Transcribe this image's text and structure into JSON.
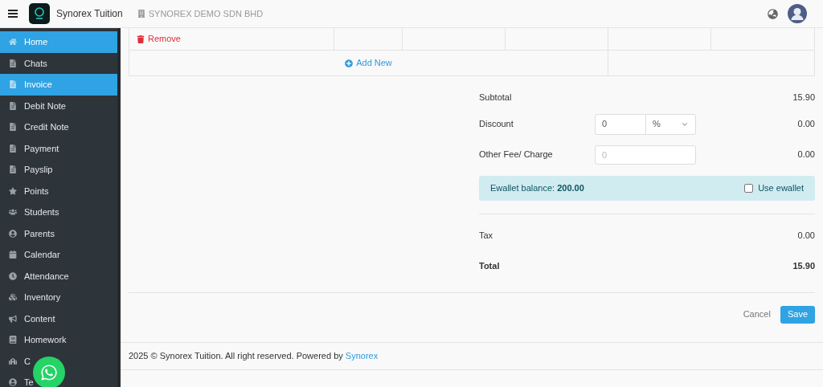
{
  "header": {
    "brand": "Synorex Tuition",
    "company": "SYNOREX DEMO SDN BHD"
  },
  "sidebar": {
    "items": [
      {
        "label": "Home",
        "kind": "home",
        "selected": true
      },
      {
        "label": "Chats",
        "kind": "doc",
        "selected": false
      },
      {
        "label": "Invoice",
        "kind": "doc",
        "selected": true
      },
      {
        "label": "Debit Note",
        "kind": "doc",
        "selected": false
      },
      {
        "label": "Credit Note",
        "kind": "doc",
        "selected": false
      },
      {
        "label": "Payment",
        "kind": "doc",
        "selected": false
      },
      {
        "label": "Payslip",
        "kind": "doc",
        "selected": false
      },
      {
        "label": "Points",
        "kind": "star",
        "selected": false
      },
      {
        "label": "Students",
        "kind": "users",
        "selected": false
      },
      {
        "label": "Parents",
        "kind": "user",
        "selected": false
      },
      {
        "label": "Calendar",
        "kind": "calendar",
        "selected": false
      },
      {
        "label": "Attendance",
        "kind": "clock",
        "selected": false
      },
      {
        "label": "Inventory",
        "kind": "boxes",
        "selected": false
      },
      {
        "label": "Content",
        "kind": "megaphone",
        "selected": false
      },
      {
        "label": "Homework",
        "kind": "book",
        "selected": false
      },
      {
        "label": "C",
        "kind": "school",
        "selected": false
      },
      {
        "label": "Te",
        "kind": "user",
        "selected": false
      }
    ]
  },
  "items_table": {
    "remove": "Remove",
    "add_new": "Add New"
  },
  "summary": {
    "subtotal_label": "Subtotal",
    "subtotal": "15.90",
    "discount_label": "Discount",
    "discount_value": "0",
    "discount_unit": "%",
    "discount": "0.00",
    "other_fee_label": "Other Fee/ Charge",
    "other_fee_placeholder": "0",
    "other_fee": "0.00",
    "ewallet": {
      "text": "Ewallet balance: **200.00**",
      "use_label": "Use ewallet",
      "checked": false
    },
    "tax_label": "Tax",
    "tax": "0.00",
    "total_label": "Total",
    "total": "15.90"
  },
  "actions": {
    "cancel": "Cancel",
    "save": "Save"
  },
  "footer": {
    "text": "2025 © Synorex Tuition. All right reserved. Powered by",
    "link": "Synorex"
  }
}
